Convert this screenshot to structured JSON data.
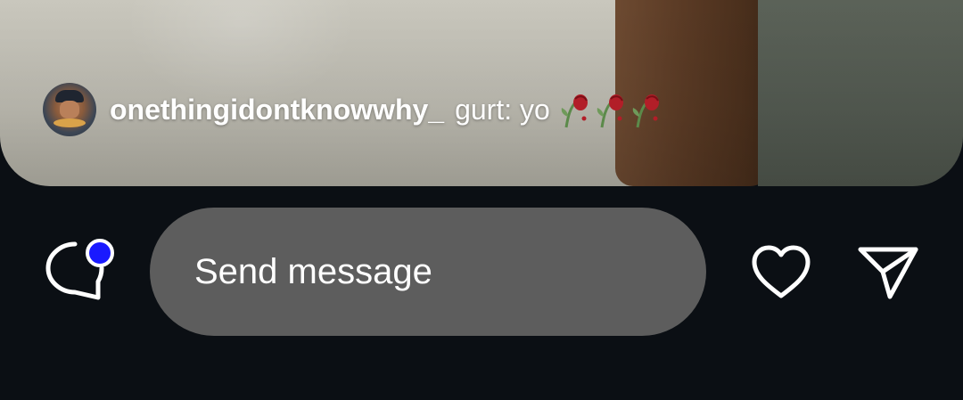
{
  "story": {
    "comment": {
      "username": "onethingidontknowwhy_",
      "message": "gurt: yo",
      "emoji": [
        "wilted-rose",
        "wilted-rose",
        "wilted-rose"
      ]
    }
  },
  "composer": {
    "placeholder": "Send message",
    "chat_icon": "chat-bubble-icon",
    "notification_dot_color": "#1a1aff",
    "like_icon": "heart-icon",
    "share_icon": "send-icon"
  },
  "colors": {
    "background": "#0b0f14",
    "field": "#5d5d5d",
    "text": "#ffffff"
  }
}
